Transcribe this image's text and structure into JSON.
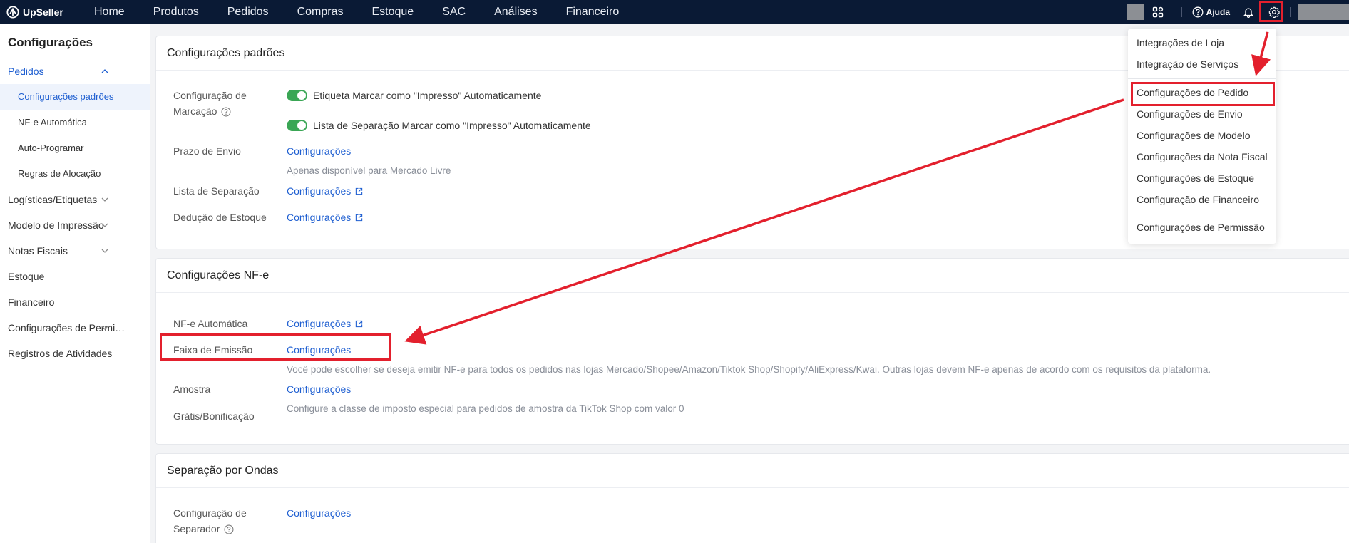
{
  "brand": {
    "name": "UpSeller"
  },
  "nav": {
    "items": [
      "Home",
      "Produtos",
      "Pedidos",
      "Compras",
      "Estoque",
      "SAC",
      "Análises",
      "Financeiro"
    ]
  },
  "header": {
    "help_label": "Ajuda",
    "icons": [
      "apps-grid-icon",
      "help-circle-icon",
      "bell-icon",
      "gear-icon"
    ]
  },
  "sidebar": {
    "title": "Configurações",
    "groups": [
      {
        "label": "Pedidos",
        "expanded": true,
        "children": [
          "Configurações padrões",
          "NF-e Automática",
          "Auto-Programar",
          "Regras de Alocação"
        ],
        "active_child": "Configurações padrões"
      },
      {
        "label": "Logísticas/Etiquetas",
        "expanded": false
      },
      {
        "label": "Modelo de Impressão",
        "expanded": false
      },
      {
        "label": "Notas Fiscais",
        "expanded": false
      },
      {
        "label": "Estoque"
      },
      {
        "label": "Financeiro"
      },
      {
        "label": "Configurações de Permi…",
        "expanded": false
      },
      {
        "label": "Registros de Atividades"
      }
    ]
  },
  "section_defaults": {
    "title": "Configurações padrões",
    "marking_label_1": "Configuração de",
    "marking_label_2": "Marcação",
    "toggle_1": {
      "label": "Etiqueta Marcar como \"Impresso\" Automaticamente",
      "on": true
    },
    "toggle_2": {
      "label": "Lista de Separação Marcar como \"Impresso\" Automaticamente",
      "on": true
    },
    "prazo_label": "Prazo de Envio",
    "prazo_link": "Configurações",
    "prazo_hint": "Apenas disponível para Mercado Livre",
    "lista_label": "Lista de Separação",
    "lista_link": "Configurações",
    "deducao_label": "Dedução de Estoque",
    "deducao_link": "Configurações"
  },
  "section_nfe": {
    "title": "Configurações NF-e",
    "auto_label": "NF-e Automática",
    "auto_link": "Configurações",
    "faixa_label": "Faixa de Emissão",
    "faixa_link": "Configurações",
    "faixa_hint": "Você pode escolher se deseja emitir NF-e para todos os pedidos nas lojas Mercado/Shopee/Amazon/Tiktok Shop/Shopify/AliExpress/Kwai. Outras lojas devem NF-e apenas de acordo com os requisitos da plataforma.",
    "amostra_label": "Amostra",
    "amostra_link": "Configurações",
    "gratis_label": "Grátis/Bonificação",
    "gratis_hint": "Configure a classe de imposto especial para pedidos de amostra da TikTok Shop com valor 0"
  },
  "section_waves": {
    "title": "Separação por Ondas",
    "sep_label_1": "Configuração de",
    "sep_label_2": "Separador",
    "sep_link": "Configurações"
  },
  "settings_menu": {
    "items": [
      "Integrações de Loja",
      "Integração de Serviços",
      "Configurações do Pedido",
      "Configurações de Envio",
      "Configurações de Modelo",
      "Configurações da Nota Fiscal",
      "Configurações de Estoque",
      "Configuração de Financeiro",
      "Configurações de Permissão"
    ],
    "highlighted": "Configurações do Pedido"
  },
  "colors": {
    "topbar": "#0a1a35",
    "accent": "#1f5fd1",
    "toggle_on": "#3aa655",
    "annotation": "#e3202d"
  }
}
